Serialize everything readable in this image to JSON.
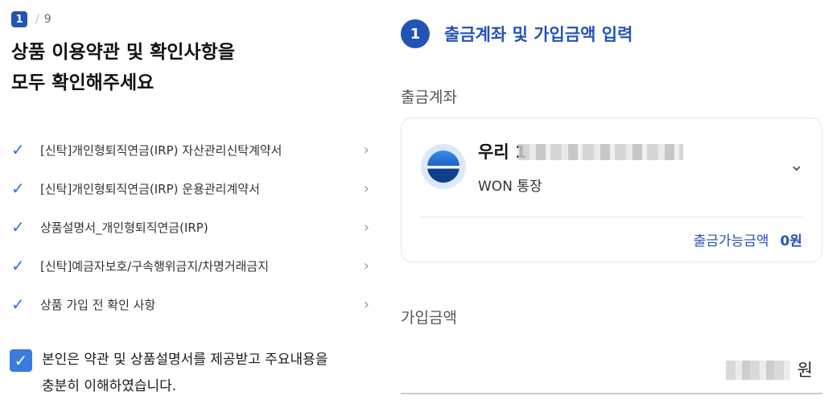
{
  "progress": {
    "current": "1",
    "total": "9"
  },
  "left": {
    "title_line1": "상품 이용약관 및 확인사항을",
    "title_line2": "모두 확인해주세요",
    "terms": [
      {
        "label": "[신탁]개인형퇴직연금(IRP) 자산관리신탁계약서"
      },
      {
        "label": "[신탁]개인형퇴직연금(IRP) 운용관리계약서"
      },
      {
        "label": "상품설명서_개인형퇴직연금(IRP)"
      },
      {
        "label": "[신탁]예금자보호/구속행위금지/차명거래금지"
      },
      {
        "label": "상품 가입 전 확인 사항"
      }
    ],
    "consent_line1": "본인은 약관 및 상품설명서를 제공받고 주요내용을",
    "consent_line2": "충분히 이해하였습니다."
  },
  "right": {
    "section_number": "1",
    "section_title": "출금계좌 및 가입금액 입력",
    "account_label": "출금계좌",
    "account": {
      "bank": "우리 1",
      "type": "WON 통장",
      "available_label": "출금가능금액",
      "available_value": "0원"
    },
    "amount_label": "가입금액",
    "amount_unit": "원"
  },
  "icons": {
    "check": "check-icon",
    "chevron_right": "chevron-right-icon",
    "chevron_down": "chevron-down-icon",
    "checkbox": "checkbox-checked-icon",
    "bank_logo": "woori-bank-logo"
  },
  "colors": {
    "accent": "#2453b8",
    "check": "#2f6fe0",
    "checkbox": "#3a7be0"
  }
}
